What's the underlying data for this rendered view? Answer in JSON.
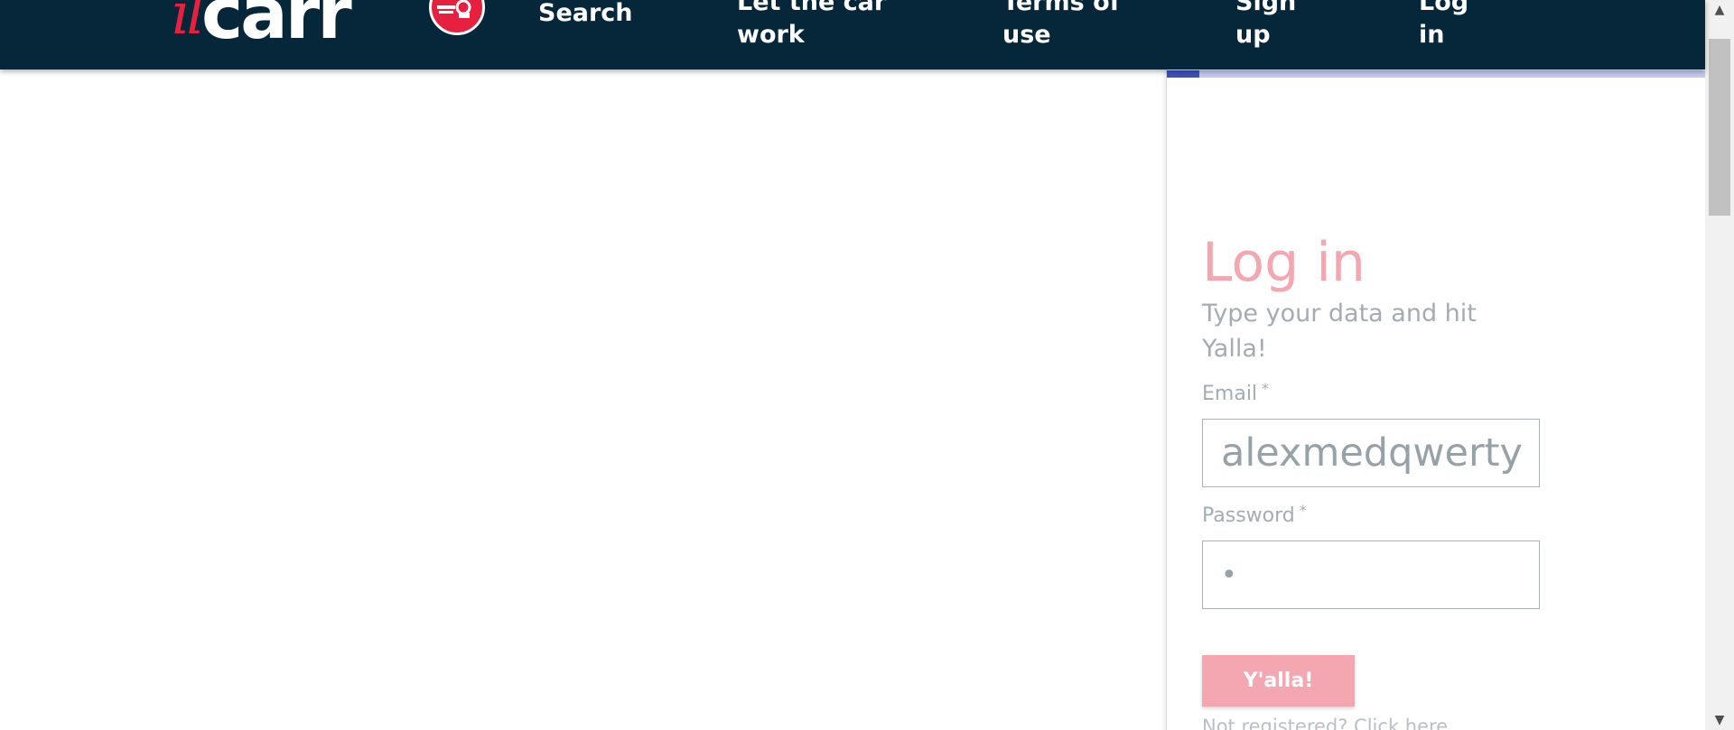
{
  "header": {
    "logo": {
      "part1": "il",
      "part2": "carr",
      "badge_icon": "car-badge-icon"
    },
    "nav": {
      "search": "Search",
      "let_the_car_work": "Let the car work",
      "terms_of_use": "Terms of use",
      "sign_up": "Sign up",
      "log_in": "Log in"
    }
  },
  "login": {
    "progress_fraction": 0.06,
    "title": "Log in",
    "subtitle": "Type your data and hit Yalla!",
    "email": {
      "label": "Email",
      "required_mark": "*",
      "value": "alexmedqwerty"
    },
    "password": {
      "label": "Password",
      "required_mark": "*",
      "value": "•"
    },
    "submit_label": "Y'alla!",
    "register_link": "Not registered? Click here"
  },
  "colors": {
    "header_bg": "#06263a",
    "brand_red": "#e8203f",
    "pink_accent": "#f4a6b1",
    "progress_fill": "#3f51b5",
    "progress_track": "#c4c9ee",
    "muted_text": "#a3acb3"
  },
  "scrollbar": {
    "up_icon": "scroll-up-arrow-icon",
    "down_icon": "scroll-down-arrow-icon"
  }
}
